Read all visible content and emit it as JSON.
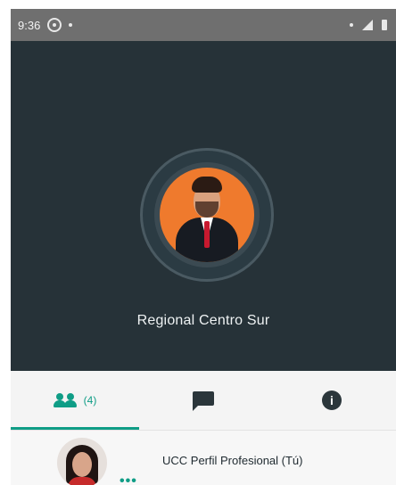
{
  "status_bar": {
    "time": "9:36",
    "icons": [
      "whatsapp-icon",
      "notification-dot",
      "wifi-icon",
      "signal-icon",
      "battery-icon"
    ]
  },
  "profile": {
    "name": "Regional Centro Sur",
    "avatar": "profile-photo"
  },
  "tabs": [
    {
      "icon": "people-icon",
      "label": "(4)",
      "active": true
    },
    {
      "icon": "chat-icon",
      "label": "",
      "active": false
    },
    {
      "icon": "info-icon",
      "label": "",
      "active": false
    }
  ],
  "members": [
    {
      "name": "UCC Perfil Profesional (Tú)",
      "more": "•••"
    }
  ],
  "colors": {
    "status_bar": "#6f6f6f",
    "hero_bg": "#263238",
    "accent": "#0f9d86",
    "tab_bar": "#f4f4f4"
  }
}
